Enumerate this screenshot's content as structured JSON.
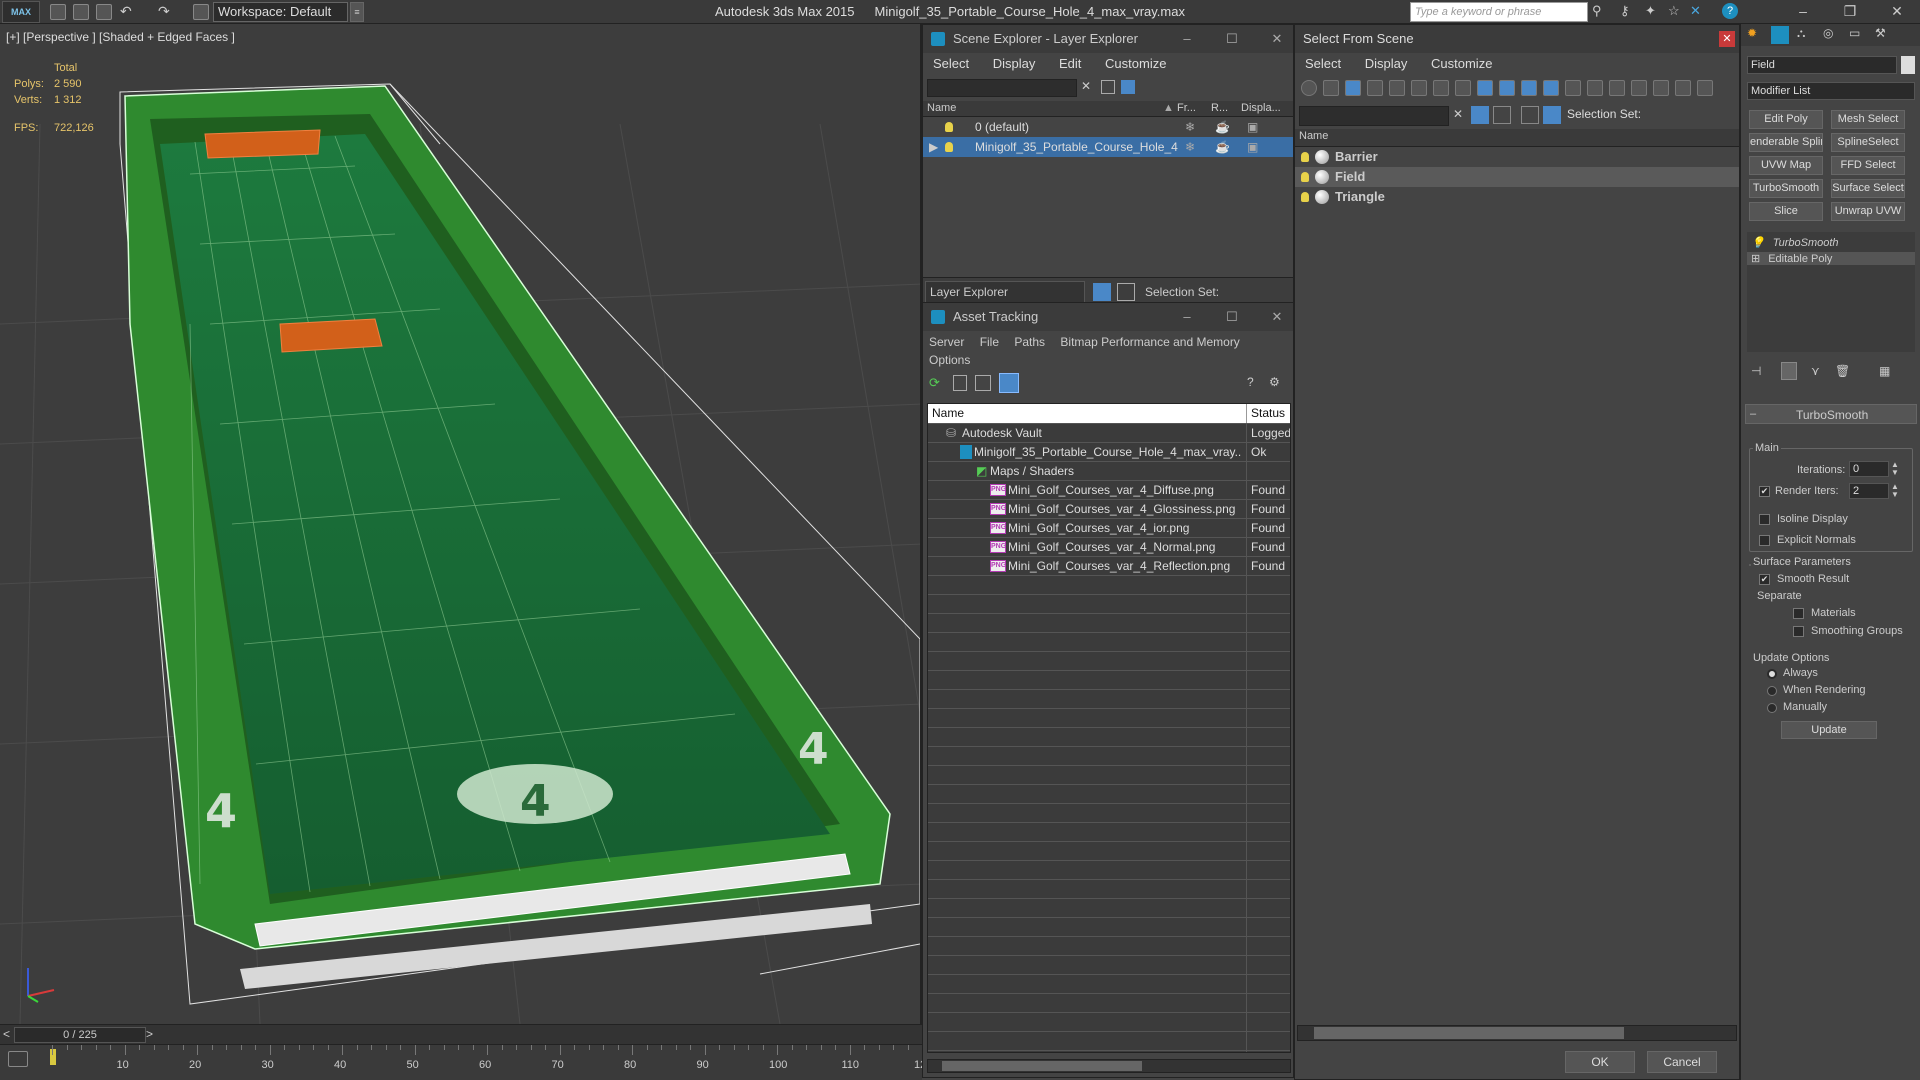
{
  "app": {
    "logo": "MAX",
    "workspace": "Workspace: Default",
    "name": "Autodesk 3ds Max  2015",
    "file": "Minigolf_35_Portable_Course_Hole_4_max_vray.max",
    "search_placeholder": "Type a keyword or phrase"
  },
  "viewport": {
    "label": "[+] [Perspective ] [Shaded + Edged Faces ]",
    "stats": {
      "total_label": "Total",
      "polys_label": "Polys:",
      "polys": "2 590",
      "verts_label": "Verts:",
      "verts": "1 312",
      "fps_label": "FPS:",
      "fps": "722,126"
    },
    "course_numbers": [
      "4",
      "4",
      "4"
    ]
  },
  "timeline": {
    "frame": "0 / 225",
    "prev": "<",
    "next": ">",
    "ticks": [
      "10",
      "20",
      "30",
      "40",
      "50",
      "60",
      "70",
      "80",
      "90",
      "100",
      "110",
      "12"
    ]
  },
  "scene_explorer": {
    "title": "Scene Explorer - Layer Explorer",
    "menu": [
      "Select",
      "Display",
      "Edit",
      "Customize"
    ],
    "columns": [
      "Name",
      "Fr...",
      "R...",
      "Displa..."
    ],
    "rows": [
      {
        "name": "0 (default)",
        "selected": false
      },
      {
        "name": "Minigolf_35_Portable_Course_Hole_4",
        "selected": true
      }
    ],
    "footer_mode": "Layer Explorer",
    "footer_selection_set": "Selection Set:"
  },
  "asset_tracking": {
    "title": "Asset Tracking",
    "menu": [
      "Server",
      "File",
      "Paths",
      "Bitmap Performance and Memory",
      "Options"
    ],
    "columns": [
      "Name",
      "Status"
    ],
    "rows": [
      {
        "name": "Autodesk Vault",
        "status": "Logged"
      },
      {
        "name": "Minigolf_35_Portable_Course_Hole_4_max_vray...",
        "status": "Ok"
      },
      {
        "name": "Maps / Shaders",
        "status": ""
      },
      {
        "name": "Mini_Golf_Courses_var_4_Diffuse.png",
        "status": "Found"
      },
      {
        "name": "Mini_Golf_Courses_var_4_Glossiness.png",
        "status": "Found"
      },
      {
        "name": "Mini_Golf_Courses_var_4_ior.png",
        "status": "Found"
      },
      {
        "name": "Mini_Golf_Courses_var_4_Normal.png",
        "status": "Found"
      },
      {
        "name": "Mini_Golf_Courses_var_4_Reflection.png",
        "status": "Found"
      }
    ],
    "png_badge": "PNG"
  },
  "select_from_scene": {
    "title": "Select From Scene",
    "menu": [
      "Select",
      "Display",
      "Customize"
    ],
    "selection_set": "Selection Set:",
    "column": "Name",
    "items": [
      {
        "name": "Barrier",
        "selected": false
      },
      {
        "name": "Field",
        "selected": true
      },
      {
        "name": "Triangle",
        "selected": false
      }
    ],
    "ok": "OK",
    "cancel": "Cancel"
  },
  "command_panel": {
    "object_name": "Field",
    "modifier_list": "Modifier List",
    "modifier_buttons": [
      "Edit Poly",
      "Mesh Select",
      "enderable Splir",
      "SplineSelect",
      "UVW Map",
      "FFD Select",
      "TurboSmooth",
      "Surface Select",
      "Slice",
      "Unwrap UVW"
    ],
    "stack": [
      "TurboSmooth",
      "Editable Poly"
    ],
    "rollout_title": "TurboSmooth",
    "main_label": "Main",
    "iterations_label": "Iterations:",
    "iterations": "0",
    "render_iters_label": "Render Iters:",
    "render_iters": "2",
    "isoline": "Isoline Display",
    "explicit_normals": "Explicit Normals",
    "surface_params": "Surface Parameters",
    "smooth_result": "Smooth Result",
    "separate": "Separate",
    "materials": "Materials",
    "smoothing_groups": "Smoothing Groups",
    "update_options": "Update Options",
    "always": "Always",
    "when_rendering": "When Rendering",
    "manually": "Manually",
    "update": "Update",
    "render_iters_checked": true,
    "smooth_result_checked": true,
    "update_mode": "Always"
  }
}
